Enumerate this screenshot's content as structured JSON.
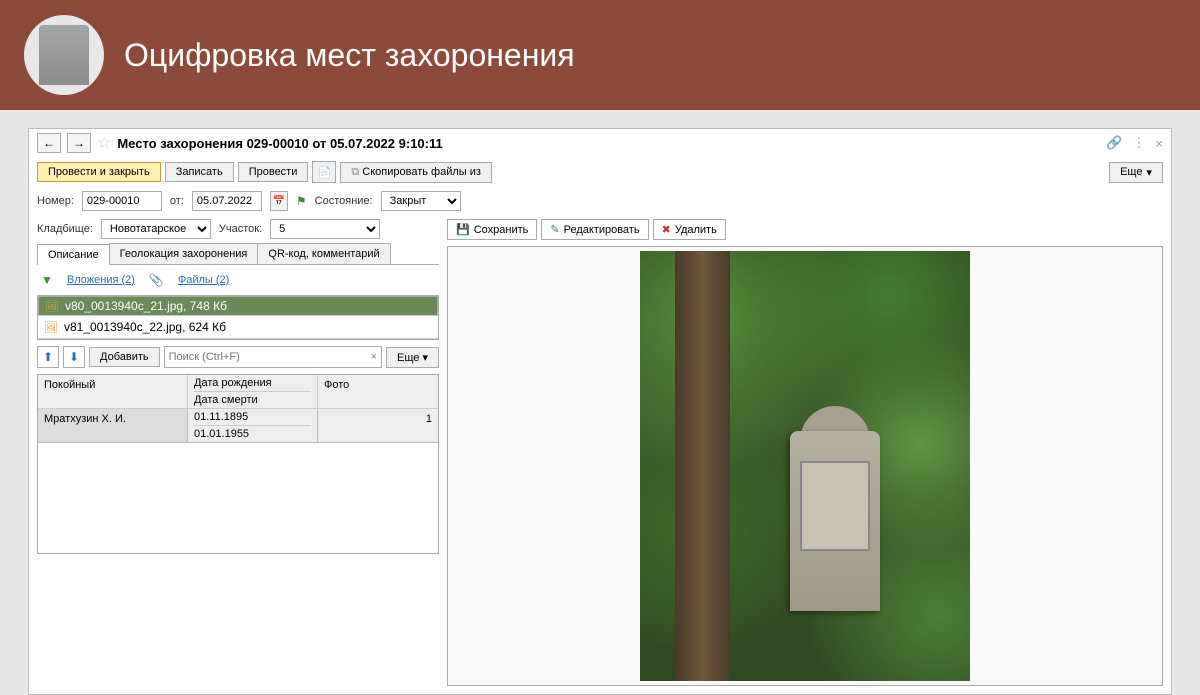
{
  "header": {
    "title": "Оцифровка мест захоронения"
  },
  "titlebar": {
    "title": "Место захоронения 029-00010 от 05.07.2022 9:10:11"
  },
  "toolbar": {
    "submit_close": "Провести и закрыть",
    "save": "Записать",
    "submit": "Провести",
    "copy_files": "Скопировать файлы из",
    "more": "Еще"
  },
  "form": {
    "number_label": "Номер:",
    "number_value": "029-00010",
    "date_label": "от:",
    "date_value": "05.07.2022",
    "state_label": "Состояние:",
    "state_value": "Закрыт",
    "cemetery_label": "Кладбище:",
    "cemetery_value": "Новотатарское",
    "plot_label": "Участок:",
    "plot_value": "5"
  },
  "tabs": {
    "desc": "Описание",
    "geo": "Геолокация захоронения",
    "qr": "QR-код, комментарий"
  },
  "attachments": {
    "expand": "Вложения (2)",
    "files": "Файлы (2)",
    "list": [
      {
        "name": "v80_0013940c_21.jpg, 748 Кб"
      },
      {
        "name": "v81_0013940c_22.jpg, 624 Кб"
      }
    ]
  },
  "row_toolbar": {
    "add": "Добавить",
    "search_ph": "Поиск (Ctrl+F)",
    "more": "Еще"
  },
  "grid": {
    "col_name": "Покойный",
    "col_dob": "Дата рождения",
    "col_dod": "Дата смерти",
    "col_photo": "Фото",
    "rows": [
      {
        "name": "Мратхузин Х. И.",
        "dob": "01.11.1895",
        "dod": "01.01.1955",
        "photo": "1"
      }
    ]
  },
  "image_toolbar": {
    "save": "Сохранить",
    "edit": "Редактировать",
    "delete": "Удалить"
  }
}
